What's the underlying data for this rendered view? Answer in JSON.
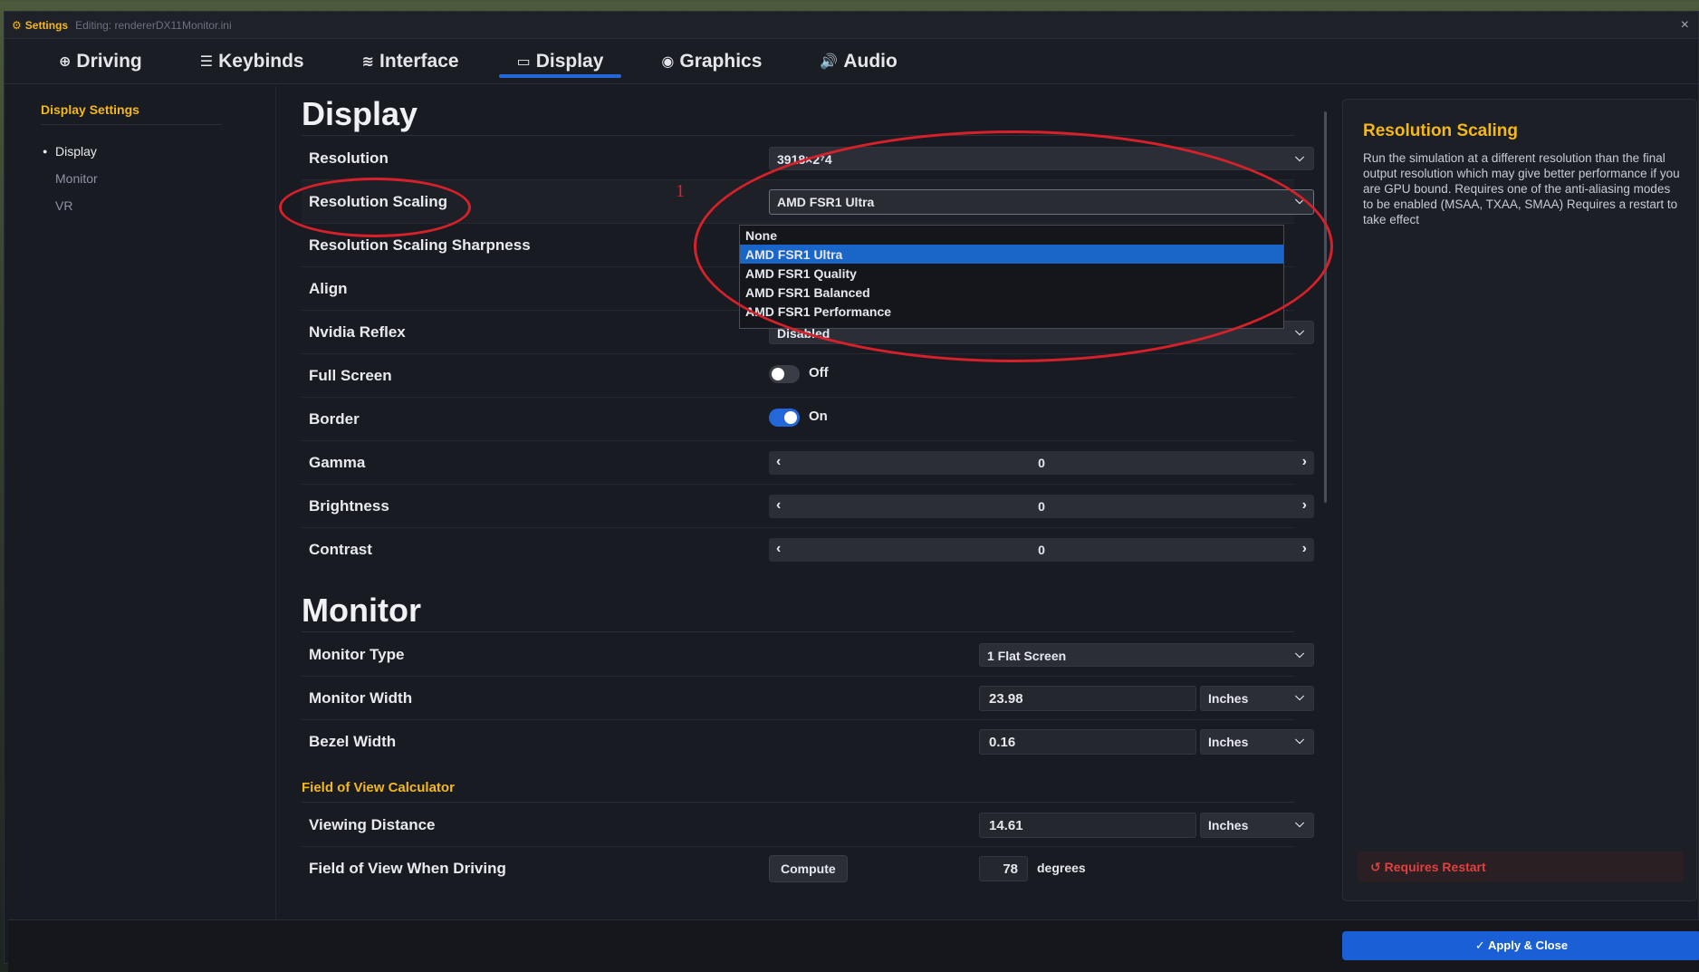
{
  "titlebar": {
    "app": "Settings",
    "editing": "Editing: rendererDX11Monitor.ini",
    "close": "×"
  },
  "tabs": [
    {
      "icon": "⊕",
      "label": "Driving"
    },
    {
      "icon": "☰",
      "label": "Keybinds"
    },
    {
      "icon": "≋",
      "label": "Interface"
    },
    {
      "icon": "▭",
      "label": "Display"
    },
    {
      "icon": "◉",
      "label": "Graphics"
    },
    {
      "icon": "🔊",
      "label": "Audio"
    }
  ],
  "sidebar": {
    "title": "Display Settings",
    "items": [
      "Display",
      "Monitor",
      "VR"
    ]
  },
  "display": {
    "heading": "Display",
    "resolution": {
      "label": "Resolution",
      "value": "3918×2⁷4"
    },
    "scaling": {
      "label": "Resolution Scaling",
      "value": "AMD FSR1 Ultra",
      "options": [
        "None",
        "AMD FSR1 Ultra",
        "AMD FSR1 Quality",
        "AMD FSR1 Balanced",
        "AMD FSR1 Performance"
      ]
    },
    "sharpness": {
      "label": "Resolution Scaling Sharpness"
    },
    "align": {
      "label": "Align"
    },
    "reflex": {
      "label": "Nvidia Reflex",
      "value": "Disabled"
    },
    "fullscreen": {
      "label": "Full Screen",
      "value": "Off"
    },
    "border": {
      "label": "Border",
      "value": "On"
    },
    "gamma": {
      "label": "Gamma",
      "value": "0"
    },
    "brightness": {
      "label": "Brightness",
      "value": "0"
    },
    "contrast": {
      "label": "Contrast",
      "value": "0"
    }
  },
  "monitor": {
    "heading": "Monitor",
    "type": {
      "label": "Monitor Type",
      "value": "1 Flat Screen"
    },
    "width": {
      "label": "Monitor Width",
      "value": "23.98",
      "unit": "Inches"
    },
    "bezel": {
      "label": "Bezel Width",
      "value": "0.16",
      "unit": "Inches"
    },
    "fov_heading": "Field of View Calculator",
    "distance": {
      "label": "Viewing Distance",
      "value": "14.61",
      "unit": "Inches"
    },
    "fov": {
      "label": "Field of View When Driving",
      "button": "Compute",
      "value": "78",
      "unit": "degrees"
    }
  },
  "info": {
    "title": "Resolution Scaling",
    "body": "Run the simulation at a different resolution than the final output resolution which may give better performance if you are GPU bound. Requires one of the anti-aliasing modes to be enabled (MSAA, TXAA, SMAA) Requires a restart to take effect",
    "restart": "Requires Restart"
  },
  "footer": {
    "apply": "Apply & Close"
  },
  "annotation": {
    "number": "1",
    "color": "#d6202a"
  },
  "chevron": "⌵"
}
